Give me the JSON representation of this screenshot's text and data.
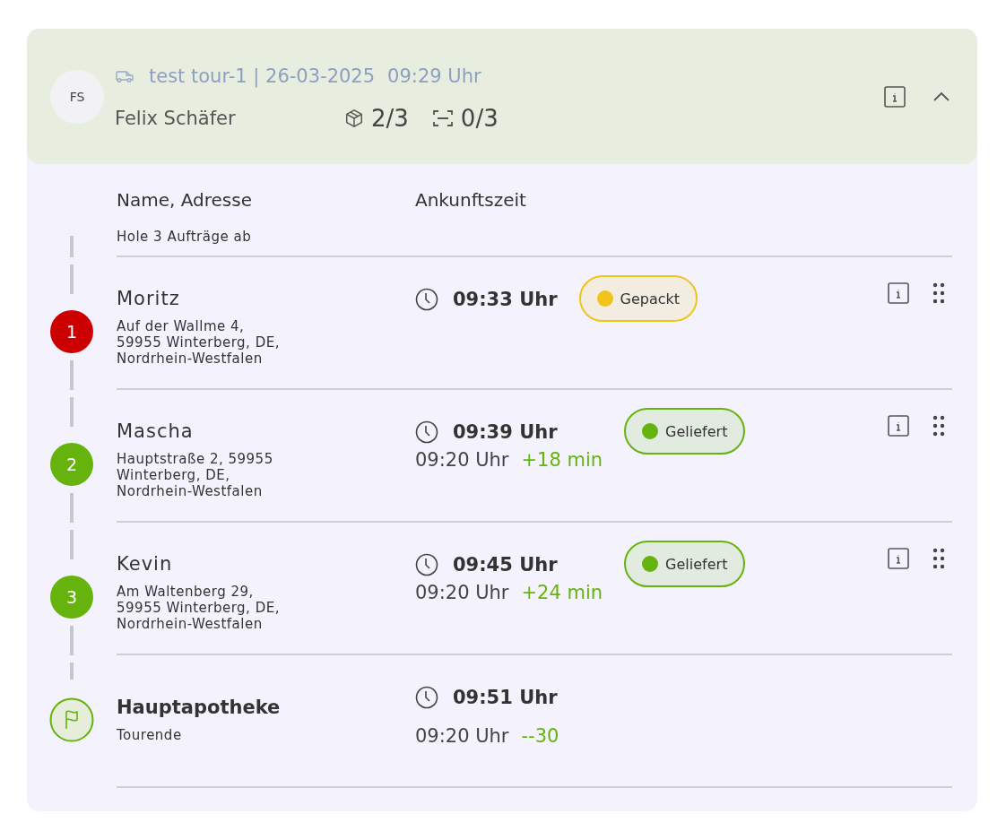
{
  "header": {
    "avatar": "FS",
    "tour": "test tour-1 | 26-03-2025",
    "time": "09:29 Uhr",
    "driver": "Felix Schäfer",
    "packages": "2/3",
    "scans": "0/3",
    "expanded": true
  },
  "columns": [
    "Name, Adresse",
    "Ankunftszeit"
  ],
  "pickup": "Hole 3 Aufträge ab",
  "stops": [
    {
      "kind": "stop",
      "number": "1",
      "color": "#cc0000",
      "name": "Moritz",
      "address": "Auf der Wallme 4,\n59955 Winterberg, DE,\nNordrhein-Westfalen",
      "eta": "09:33 Uhr",
      "status": {
        "label": "Gepackt",
        "color": "#f0c419"
      }
    },
    {
      "kind": "stop",
      "number": "2",
      "color": "#66b30e",
      "name": "Mascha",
      "address": "Hauptstraße 2, 59955\nWinterberg, DE,\nNordrhein-Westfalen",
      "eta": "09:39 Uhr",
      "actual": "09:20 Uhr",
      "delta": "+18 min",
      "status": {
        "label": "Geliefert",
        "color": "#66b30e"
      }
    },
    {
      "kind": "stop",
      "number": "3",
      "color": "#66b30e",
      "name": "Kevin",
      "address": "Am Waltenberg 29,\n59955 Winterberg, DE,\nNordrhein-Westfalen",
      "eta": "09:45 Uhr",
      "actual": "09:20 Uhr",
      "delta": "+24 min",
      "status": {
        "label": "Geliefert",
        "color": "#66b30e"
      }
    },
    {
      "kind": "end",
      "name": "Hauptapotheke",
      "address": "Tourende",
      "eta": "09:51 Uhr",
      "actual": "09:20 Uhr",
      "delta": "--30"
    }
  ]
}
